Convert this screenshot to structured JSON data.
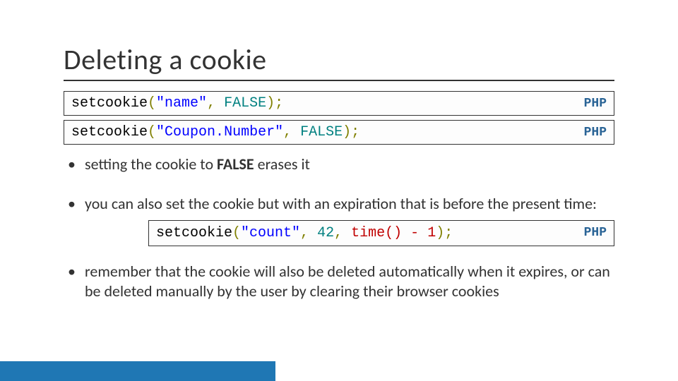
{
  "title": "Deleting a cookie",
  "code1": {
    "tokens": {
      "fn": "setcookie",
      "p1": "(",
      "arg1": "\"name\"",
      "comma": ",",
      "sp": " ",
      "false": "FALSE",
      "p2": ")",
      "semi": ";"
    },
    "label": "PHP"
  },
  "code2": {
    "tokens": {
      "fn": "setcookie",
      "p1": "(",
      "arg1": "\"Coupon.Number\"",
      "comma": ",",
      "sp": " ",
      "false": "FALSE",
      "p2": ")",
      "semi": ";"
    },
    "label": "PHP"
  },
  "bullet1_pre": "setting the cookie to ",
  "bullet1_bold": "FALSE",
  "bullet1_post": " erases it",
  "bullet2": "you can also set the cookie but with an expiration that is before the present time:",
  "code3": {
    "tokens": {
      "fn": "setcookie",
      "p1": "(",
      "arg1": "\"count\"",
      "c1": ",",
      "sp1": " ",
      "num": "42",
      "c2": ",",
      "sp2": " ",
      "time": "time()",
      "sp3": " ",
      "minus": "-",
      "sp4": " ",
      "one": "1",
      "p2": ")",
      "semi": ";"
    },
    "label": "PHP"
  },
  "bullet3": "remember that the cookie will also be deleted automatically when it expires, or can be deleted manually by the user by clearing their browser cookies"
}
